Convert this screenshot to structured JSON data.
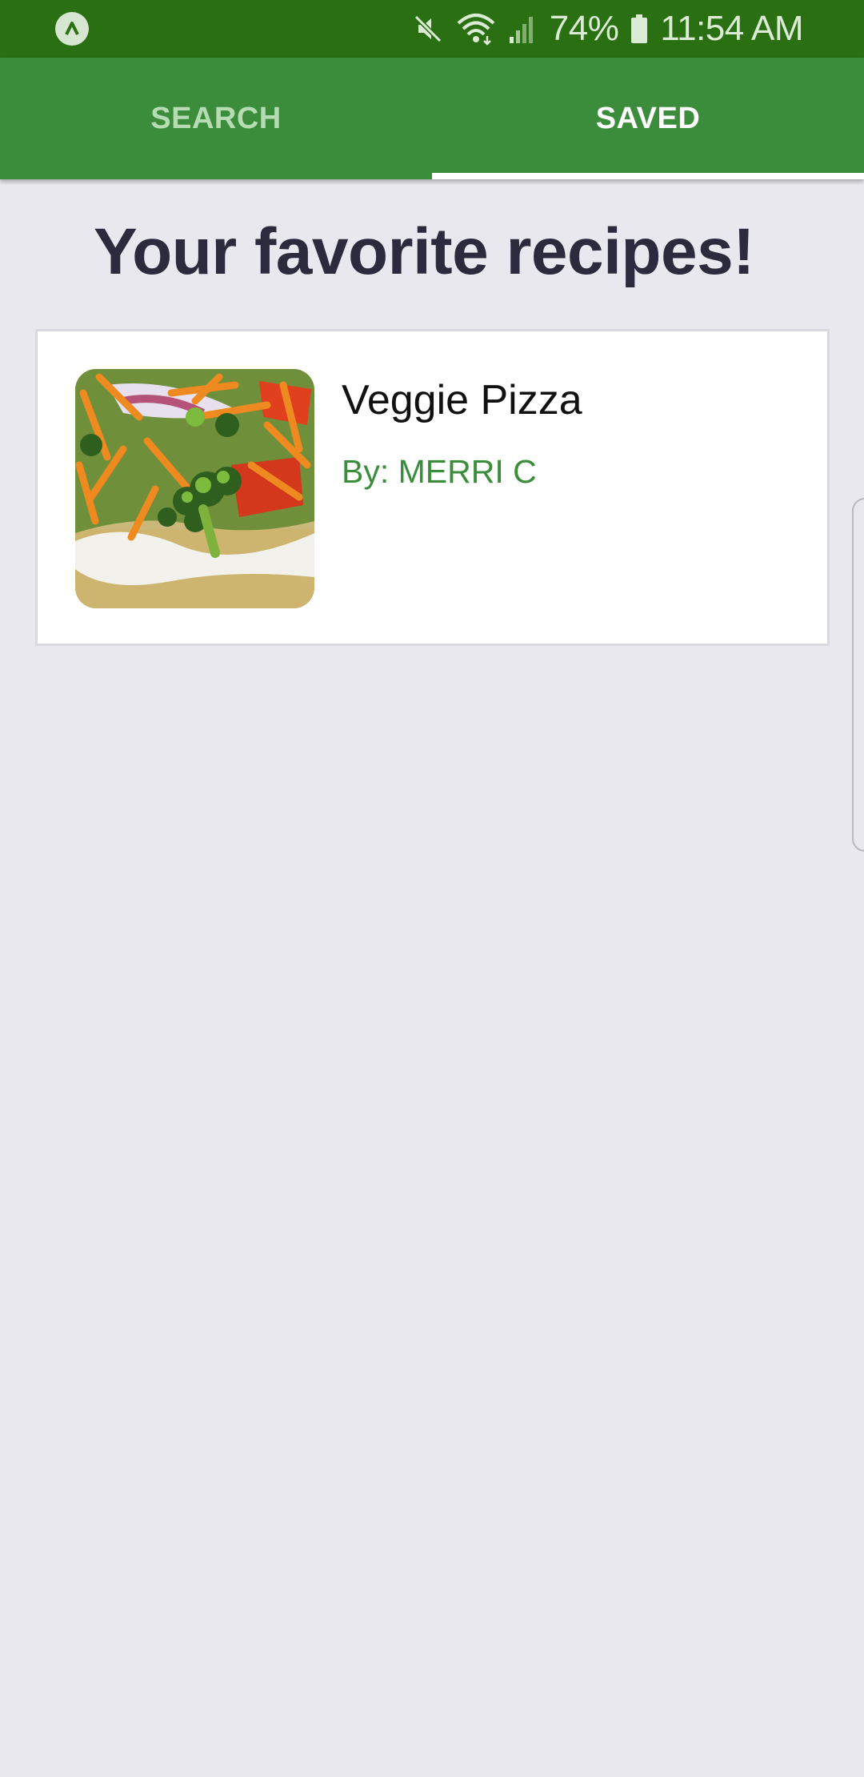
{
  "status_bar": {
    "battery": "74%",
    "time": "11:54 AM",
    "icons": [
      "app-logo-icon",
      "mute-icon",
      "wifi-icon",
      "signal-icon",
      "battery-icon"
    ]
  },
  "tabs": [
    {
      "label": "SEARCH",
      "active": false
    },
    {
      "label": "SAVED",
      "active": true
    }
  ],
  "page": {
    "title": "Your favorite recipes!"
  },
  "recipes": [
    {
      "name": "Veggie Pizza",
      "author": "By: MERRI C",
      "thumbnail": "veggie-pizza-photo"
    }
  ],
  "colors": {
    "status_bar": "#2a6f12",
    "tab_bar": "#3b8d3c",
    "background": "#e8e8ee",
    "accent": "#3b8d3c",
    "title": "#2b2b3d"
  }
}
